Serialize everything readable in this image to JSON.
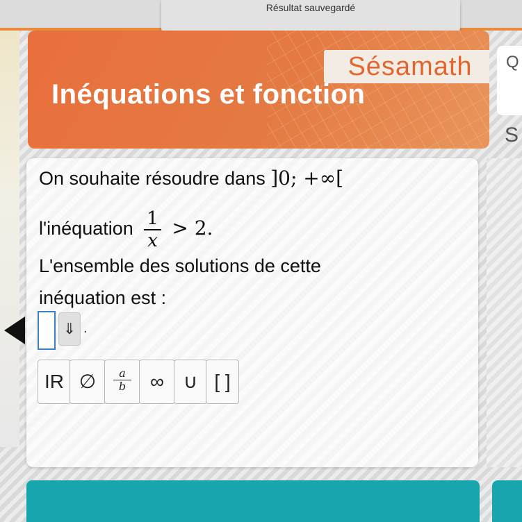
{
  "status": {
    "saved_text": "Résultat sauvegardé"
  },
  "header": {
    "logo_text": "Sésamath",
    "title": "Inéquations et fonction"
  },
  "side": {
    "right_top_letter": "Q",
    "right_bottom_letter": "S"
  },
  "question": {
    "line1_text": "On souhaite résoudre dans",
    "line1_math": "]0; +∞[",
    "line2_text": "l'inéquation",
    "frac_num": "1",
    "frac_den": "x",
    "line2_after": "> 2.",
    "line3": "L'ensemble des solutions de cette",
    "line4": "inéquation est :"
  },
  "answer": {
    "arrow_symbol": "⇓",
    "trailing": "."
  },
  "keyboard": {
    "keys": [
      {
        "label": "IR"
      },
      {
        "label": "∅"
      },
      {
        "num": "a",
        "den": "b"
      },
      {
        "label": "∞"
      },
      {
        "label": "∪"
      },
      {
        "label": "[ ]"
      }
    ]
  },
  "colors": {
    "accent": "#e96f3c",
    "teal": "#17a6ad",
    "answer_border": "#3c7ec3"
  }
}
